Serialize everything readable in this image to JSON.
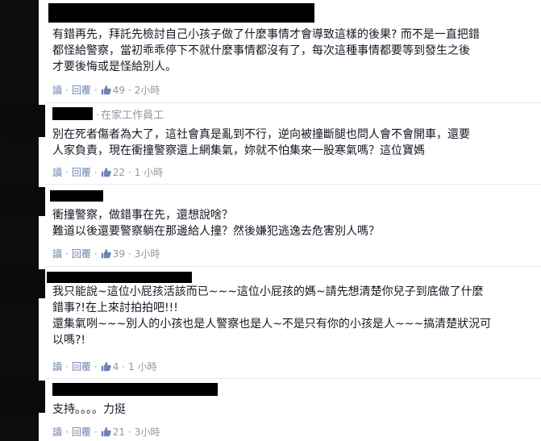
{
  "comments": [
    {
      "author_meta": "",
      "body": "有錯再先，拜託先檢討自己小孩子做了什麼事情才會導致這樣的後果? 而不是一直把錯\n都怪給警察，當初乖乖停下不就什麼事情都沒有了，每次這種事情都要等到發生之後\n才要後悔或是怪給別人。",
      "reply_label": "讀",
      "reply2_label": "回覆",
      "likes": "49",
      "time": "2小時"
    },
    {
      "author_meta": "在家工作員工",
      "body": "別在死者傷者為大了，這社會真是亂到不行，逆向被撞斷腿也問人會不會開車，還要\n人家負責，現在衝撞警察還上網集氣，妳就不怕集來一股寒氣嗎？這位寶媽",
      "reply_label": "讀",
      "reply2_label": "回覆",
      "likes": "22",
      "time": "1 小時"
    },
    {
      "author_meta": "",
      "body": "衝撞警察，做錯事在先，還想說啥？\n難道以後還要警察躺在那邊給人撞？然後嫌犯逃逸去危害別人嗎？",
      "reply_label": "讀",
      "reply2_label": "回覆",
      "likes": "39",
      "time": "3小時"
    },
    {
      "author_meta": "",
      "body": "我只能說~這位小屁孩活該而已~~~這位小屁孩的媽~請先想清楚你兒子到底做了什麼\n錯事?!在上來討拍拍吧!!!\n還集氣咧~~~別人的小孩也是人警察也是人~不是只有你的小孩是人~~~搞清楚狀況可\n以嗎?!",
      "reply_label": "讀",
      "reply2_label": "回覆",
      "likes": "4",
      "time": "1 小時"
    },
    {
      "author_meta": "",
      "body": "支持。。。。力挺",
      "reply_label": "讀",
      "reply2_label": "回覆",
      "likes": "21",
      "time": "3小時"
    }
  ],
  "colors": {
    "link": "#6d84b4",
    "meta": "#9197a3",
    "text": "#141823",
    "redaction": "#000000"
  },
  "icons": {
    "like": "thumbs-up-icon"
  }
}
